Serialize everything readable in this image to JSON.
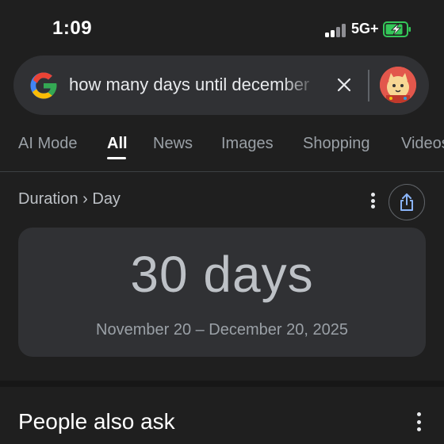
{
  "status_bar": {
    "time": "1:09",
    "network": "5G+",
    "signal_icon": "cellular-signal-icon",
    "battery_icon": "battery-charging-icon"
  },
  "search": {
    "query": "how many days until december",
    "logo_icon": "google-g-logo",
    "clear_icon": "close-icon"
  },
  "tabs": [
    {
      "label": "AI Mode",
      "active": false
    },
    {
      "label": "All",
      "active": true
    },
    {
      "label": "News",
      "active": false
    },
    {
      "label": "Images",
      "active": false
    },
    {
      "label": "Shopping",
      "active": false
    },
    {
      "label": "Videos",
      "active": false
    }
  ],
  "result": {
    "breadcrumb": "Duration › Day",
    "value": "30 days",
    "date_range": "November 20 – December 20, 2025"
  },
  "people_also_ask": {
    "title": "People also ask"
  },
  "colors": {
    "background": "#1f1f1f",
    "card": "#303134",
    "google_blue": "#4285f4",
    "google_red": "#ea4335",
    "google_yellow": "#fbbc05",
    "google_green": "#34a853",
    "battery_green": "#34c759"
  }
}
